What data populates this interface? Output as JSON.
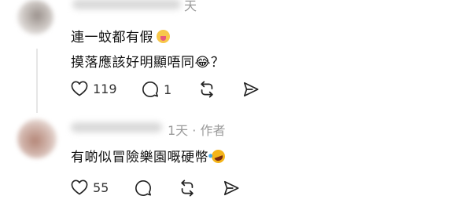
{
  "comments": [
    {
      "username": "",
      "time": "天",
      "lines": [
        "連一蚊都有假",
        "摸落應該好明顯唔同😂？"
      ],
      "emoji_icon": "drooling-face-icon",
      "likes": "119",
      "replies": "1"
    },
    {
      "username": "",
      "time_author": "1天 · 作者",
      "lines": [
        "有啲似冒險樂園嘅硬幣"
      ],
      "emoji_icon": "rolling-laughing-face-icon",
      "likes": "55",
      "replies": ""
    }
  ],
  "icons": {
    "like": "heart-icon",
    "reply": "comment-bubble-icon",
    "repost": "repost-icon",
    "share": "send-icon"
  }
}
